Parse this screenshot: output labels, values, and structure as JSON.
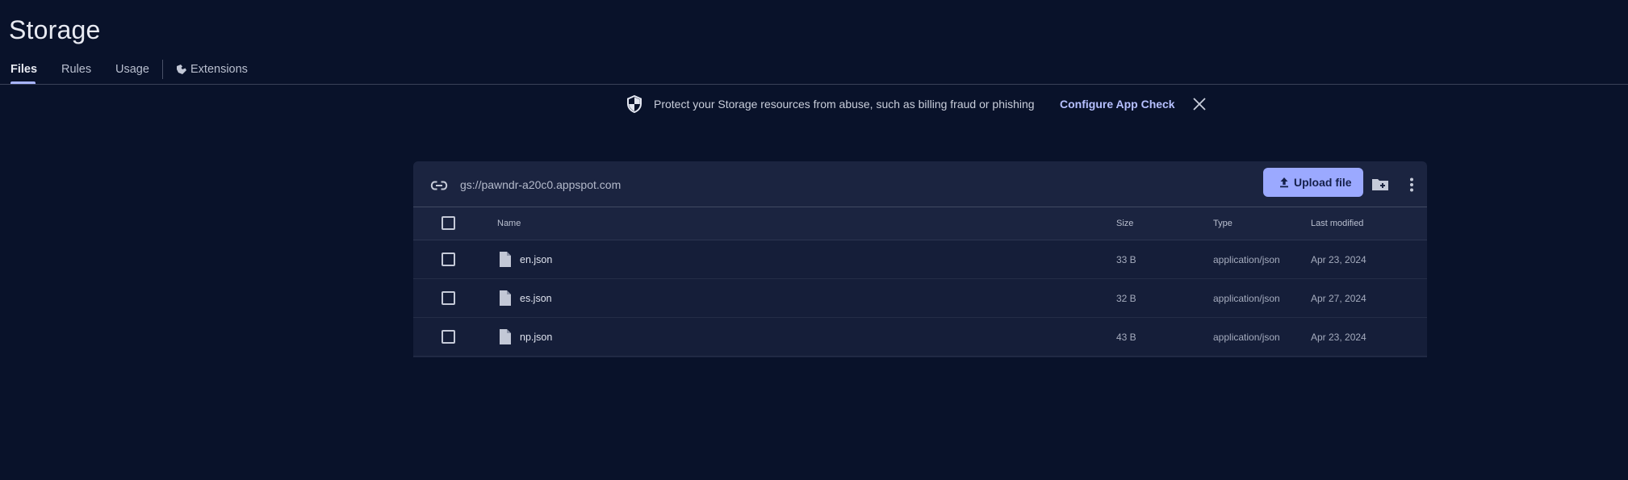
{
  "page": {
    "title": "Storage"
  },
  "tabs": {
    "files": "Files",
    "rules": "Rules",
    "usage": "Usage",
    "extensions": "Extensions",
    "active": "Files"
  },
  "banner": {
    "message": "Protect your Storage resources from abuse, such as billing fraud or phishing",
    "action_label": "Configure App Check",
    "icon": "shield-icon",
    "close_icon": "close-icon"
  },
  "browser": {
    "bucket_path": "gs://pawndr-a20c0.appspot.com",
    "upload_label": "Upload file",
    "icons": {
      "link": "link-icon",
      "upload": "upload-icon",
      "new_folder": "create-folder-icon",
      "more": "more-vert-icon",
      "file": "file-icon"
    },
    "columns": {
      "name": "Name",
      "size": "Size",
      "type": "Type",
      "modified": "Last modified"
    },
    "rows": [
      {
        "name": "en.json",
        "size": "33 B",
        "type": "application/json",
        "modified": "Apr 23, 2024"
      },
      {
        "name": "es.json",
        "size": "32 B",
        "type": "application/json",
        "modified": "Apr 27, 2024"
      },
      {
        "name": "np.json",
        "size": "43 B",
        "type": "application/json",
        "modified": "Apr 23, 2024"
      }
    ]
  },
  "colors": {
    "background": "#09122a",
    "card": "#1b2440",
    "row": "#151e39",
    "accent": "#9ba9ff",
    "link": "#b6c0ff"
  }
}
